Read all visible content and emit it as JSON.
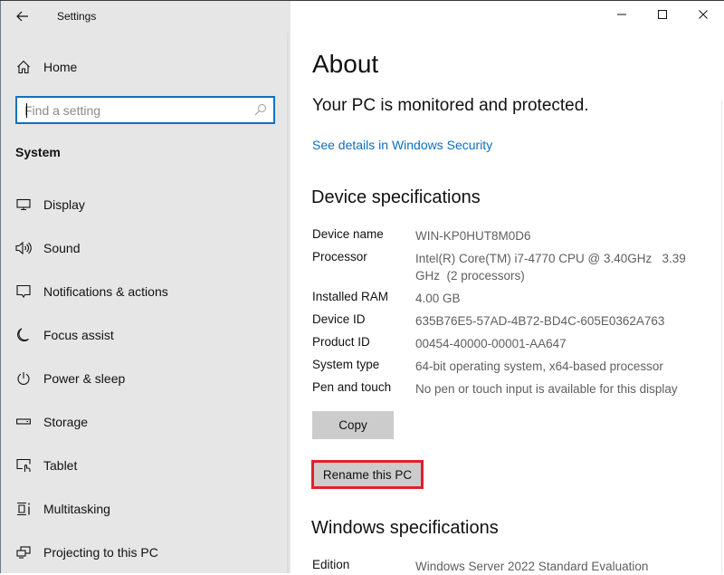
{
  "window": {
    "title": "Settings",
    "controls": {
      "minimize": "minimize",
      "maximize": "maximize",
      "close": "close"
    }
  },
  "sidebar": {
    "home_label": "Home",
    "search_placeholder": "Find a setting",
    "search_value": "",
    "section_heading": "System",
    "items": [
      {
        "label": "Display",
        "icon": "display-icon"
      },
      {
        "label": "Sound",
        "icon": "sound-icon"
      },
      {
        "label": "Notifications & actions",
        "icon": "notifications-icon"
      },
      {
        "label": "Focus assist",
        "icon": "moon-icon"
      },
      {
        "label": "Power & sleep",
        "icon": "power-icon"
      },
      {
        "label": "Storage",
        "icon": "storage-icon"
      },
      {
        "label": "Tablet",
        "icon": "tablet-icon"
      },
      {
        "label": "Multitasking",
        "icon": "multitasking-icon"
      },
      {
        "label": "Projecting to this PC",
        "icon": "projecting-icon"
      }
    ]
  },
  "main": {
    "title": "About",
    "protection_status": "Your PC is monitored and protected.",
    "security_link": "See details in Windows Security",
    "device_specs": {
      "heading": "Device specifications",
      "rows": [
        {
          "label": "Device name",
          "value": "WIN-KP0HUT8M0D6"
        },
        {
          "label": "Processor",
          "value": "Intel(R) Core(TM) i7-4770 CPU @ 3.40GHz   3.39 GHz  (2 processors)"
        },
        {
          "label": "Installed RAM",
          "value": "4.00 GB"
        },
        {
          "label": "Device ID",
          "value": "635B76E5-57AD-4B72-BD4C-605E0362A763"
        },
        {
          "label": "Product ID",
          "value": "00454-40000-00001-AA647"
        },
        {
          "label": "System type",
          "value": "64-bit operating system, x64-based processor"
        },
        {
          "label": "Pen and touch",
          "value": "No pen or touch input is available for this display"
        }
      ],
      "copy_button": "Copy",
      "rename_button": "Rename this PC"
    },
    "windows_specs": {
      "heading": "Windows specifications",
      "rows": [
        {
          "label": "Edition",
          "value": "Windows Server 2022 Standard Evaluation"
        }
      ]
    }
  },
  "colors": {
    "accent": "#0a73c2",
    "link": "#0a6fc2",
    "highlight": "#e1202c",
    "sidebar_bg": "#e6e6e6",
    "button_bg": "#cccccc"
  }
}
